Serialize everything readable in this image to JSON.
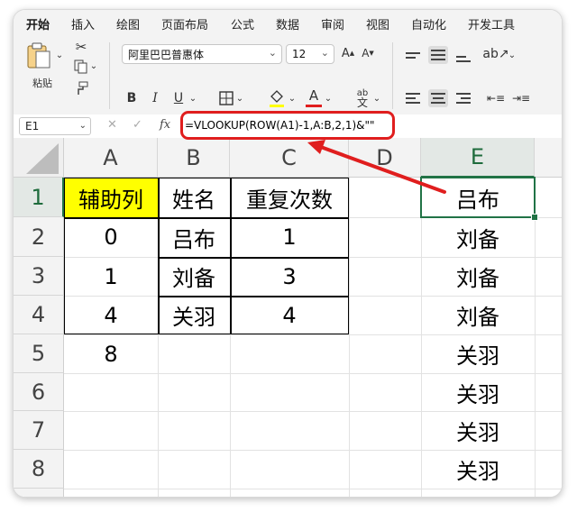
{
  "ribbon_tabs": [
    "开始",
    "插入",
    "绘图",
    "页面布局",
    "公式",
    "数据",
    "审阅",
    "视图",
    "自动化",
    "开发工具"
  ],
  "ribbon": {
    "paste_label": "粘贴",
    "font_name": "阿里巴巴普惠体",
    "font_size": "12",
    "bold": "B",
    "italic": "I",
    "underline": "U",
    "font_color_glyph": "A",
    "wrap_label": "ab",
    "icons": [
      "paste-icon",
      "cut-icon",
      "copy-icon",
      "format-painter-icon",
      "increase-font-icon",
      "decrease-font-icon",
      "borders-icon",
      "fill-color-icon",
      "font-color-icon",
      "phonetic-icon",
      "align-top-icon",
      "align-middle-icon",
      "align-bottom-icon",
      "orientation-icon",
      "align-left-icon",
      "align-center-icon",
      "align-right-icon",
      "decrease-indent-icon",
      "increase-indent-icon"
    ]
  },
  "formula_bar": {
    "name_box": "E1",
    "fx": "fx",
    "formula": "=VLOOKUP(ROW(A1)-1,A:B,2,1)&\"\""
  },
  "grid": {
    "columns": [
      "A",
      "B",
      "C",
      "D",
      "E"
    ],
    "rows": [
      "1",
      "2",
      "3",
      "4",
      "5",
      "6",
      "7",
      "8"
    ],
    "selected_cell": "E1",
    "cells": {
      "A": [
        "辅助列",
        "0",
        "1",
        "4",
        "8",
        "",
        "",
        ""
      ],
      "B": [
        "姓名",
        "吕布",
        "刘备",
        "关羽",
        "",
        "",
        "",
        ""
      ],
      "C": [
        "重复次数",
        "1",
        "3",
        "4",
        "",
        "",
        "",
        ""
      ],
      "D": [
        "",
        "",
        "",
        "",
        "",
        "",
        "",
        ""
      ],
      "E": [
        "吕布",
        "刘备",
        "刘备",
        "刘备",
        "关羽",
        "关羽",
        "关羽",
        "关羽"
      ]
    }
  },
  "colors": {
    "highlight": "#ffff00",
    "selection": "#217346",
    "annotation": "#e01e1e"
  }
}
